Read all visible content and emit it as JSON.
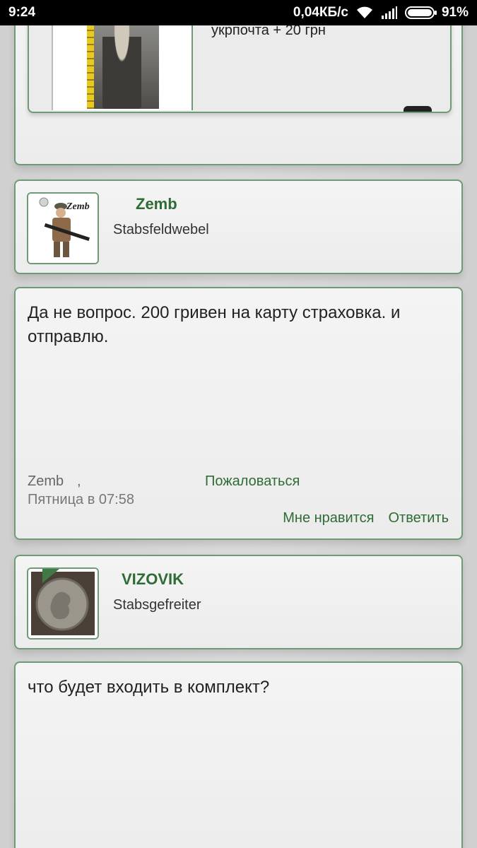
{
  "status_bar": {
    "time": "9:24",
    "speed": "0,04КБ/с",
    "battery": "91%",
    "icons": [
      "wifi-icon",
      "signal-icon",
      "battery-icon"
    ]
  },
  "quote_block": {
    "text": "укрпочта + 20 грн"
  },
  "posts": [
    {
      "author": "Zemb",
      "rank": "Stabsfeldwebel",
      "avatar_label": "Zemb",
      "text": "Да не вопрос. 200 гривен на карту страховка. и отправлю.",
      "meta_author": "Zemb",
      "meta_comma": ",",
      "report": "Пожаловаться",
      "date": "Пятница в 07:58",
      "like": "Мне нравится",
      "reply": "Ответить"
    },
    {
      "author": "VIZOVIK",
      "rank": "Stabsgefreiter",
      "text": "что будет входить в комплект?"
    }
  ],
  "colors": {
    "accent_green": "#2f6b34",
    "border_green": "#6f9a76"
  }
}
